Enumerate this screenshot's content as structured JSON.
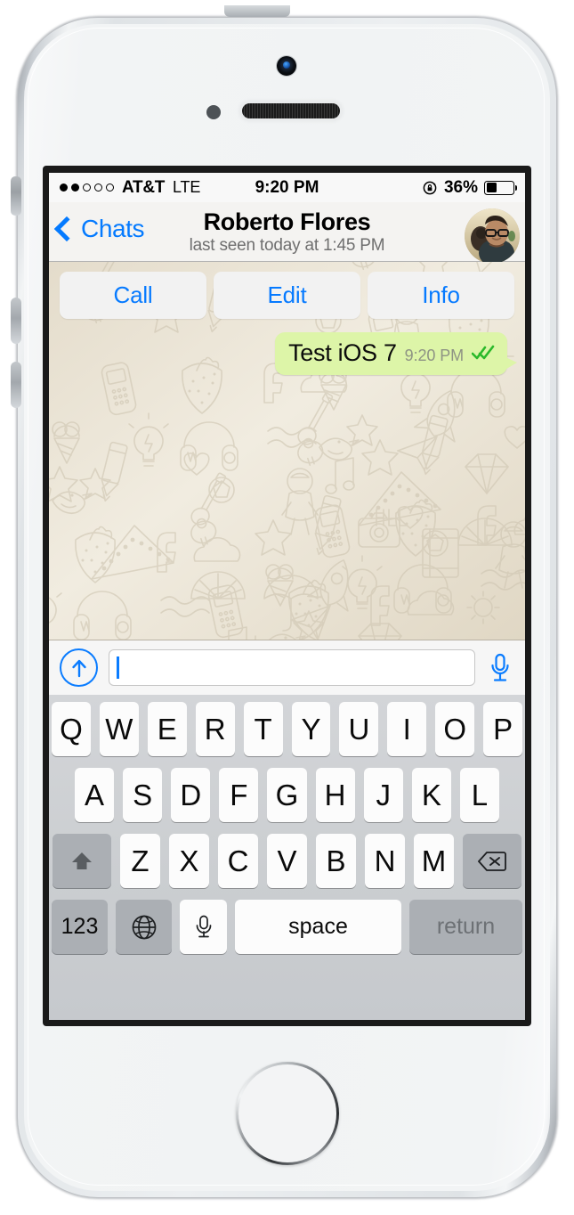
{
  "device": {
    "name": "iphone-5s-white",
    "camera_icon": "front-camera",
    "speaker_icon": "earpiece-speaker",
    "home_button_icon": "home-button"
  },
  "status_bar": {
    "signal_dots_filled": 2,
    "signal_dots_total": 5,
    "carrier": "AT&T",
    "radio": "LTE",
    "time": "9:20 PM",
    "rotation_lock_icon": "rotation-lock-icon",
    "battery_percent_label": "36%",
    "battery_level": 36
  },
  "nav_bar": {
    "back_label": "Chats",
    "back_icon": "chevron-left-icon",
    "title": "Roberto Flores",
    "subtitle": "last seen today at 1:45 PM",
    "avatar_icon": "contact-avatar",
    "accent_color": "#047aff"
  },
  "action_bar": {
    "buttons": [
      {
        "label": "Call",
        "name": "call-button"
      },
      {
        "label": "Edit",
        "name": "edit-button"
      },
      {
        "label": "Info",
        "name": "info-button"
      }
    ]
  },
  "chat": {
    "wallpaper": "whatsapp-doodle-wallpaper",
    "wallpaper_color": "#ece5d8",
    "messages": [
      {
        "text": "Test iOS 7",
        "time": "9:20 PM",
        "status_icon": "double-check-icon",
        "outgoing": true,
        "bubble_color": "#ddf5a8"
      }
    ]
  },
  "input_bar": {
    "attach_icon": "attach-up-arrow-icon",
    "text_value": "",
    "placeholder": "",
    "mic_icon": "microphone-icon"
  },
  "keyboard": {
    "row1": [
      "Q",
      "W",
      "E",
      "R",
      "T",
      "Y",
      "U",
      "I",
      "O",
      "P"
    ],
    "row2": [
      "A",
      "S",
      "D",
      "F",
      "G",
      "H",
      "J",
      "K",
      "L"
    ],
    "row3": [
      "Z",
      "X",
      "C",
      "V",
      "B",
      "N",
      "M"
    ],
    "shift_icon": "shift-icon",
    "delete_icon": "backspace-icon",
    "numbers_label": "123",
    "globe_icon": "globe-icon",
    "dictation_icon": "microphone-icon",
    "space_label": "space",
    "return_label": "return"
  }
}
